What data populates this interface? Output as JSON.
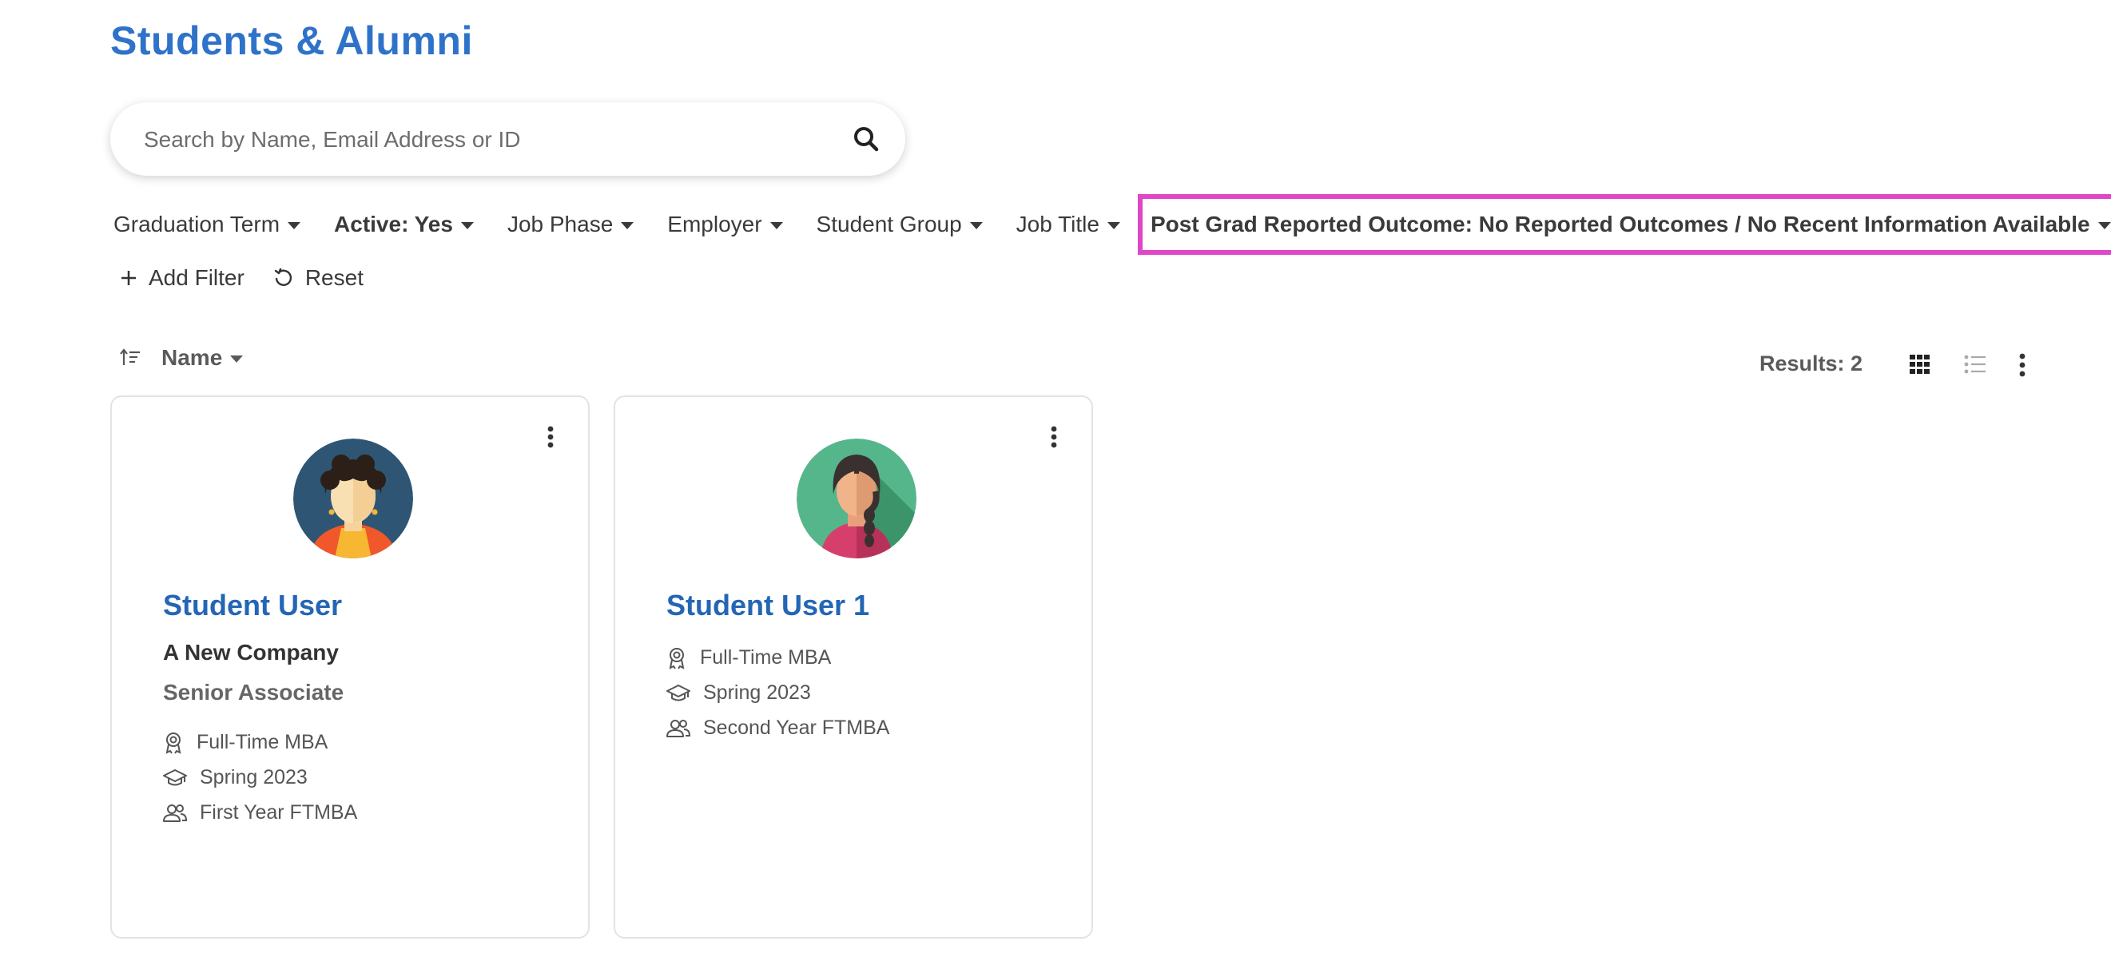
{
  "page": {
    "title": "Students & Alumni"
  },
  "search": {
    "placeholder": "Search by Name, Email Address or ID"
  },
  "filters": {
    "graduation_term": "Graduation Term",
    "active": "Active: Yes",
    "job_phase": "Job Phase",
    "employer": "Employer",
    "student_group": "Student Group",
    "job_title": "Job Title",
    "post_grad_outcome": "Post Grad Reported Outcome: No Reported Outcomes / No Recent Information Available",
    "add_filter": "Add Filter",
    "reset": "Reset"
  },
  "sort": {
    "label": "Name"
  },
  "results": {
    "text": "Results: 2"
  },
  "colors": {
    "title_blue": "#2f72c9",
    "name_blue": "#2466b5",
    "highlight": "#e046c8"
  },
  "cards": [
    {
      "name": "Student User",
      "company": "A New Company",
      "job_title": "Senior Associate",
      "program": "Full-Time MBA",
      "term": "Spring 2023",
      "group": "First Year FTMBA",
      "avatar_icon": "woman-avatar-icon"
    },
    {
      "name": "Student User 1",
      "program": "Full-Time MBA",
      "term": "Spring 2023",
      "group": "Second Year FTMBA",
      "avatar_icon": "woman-braid-avatar-icon"
    }
  ]
}
